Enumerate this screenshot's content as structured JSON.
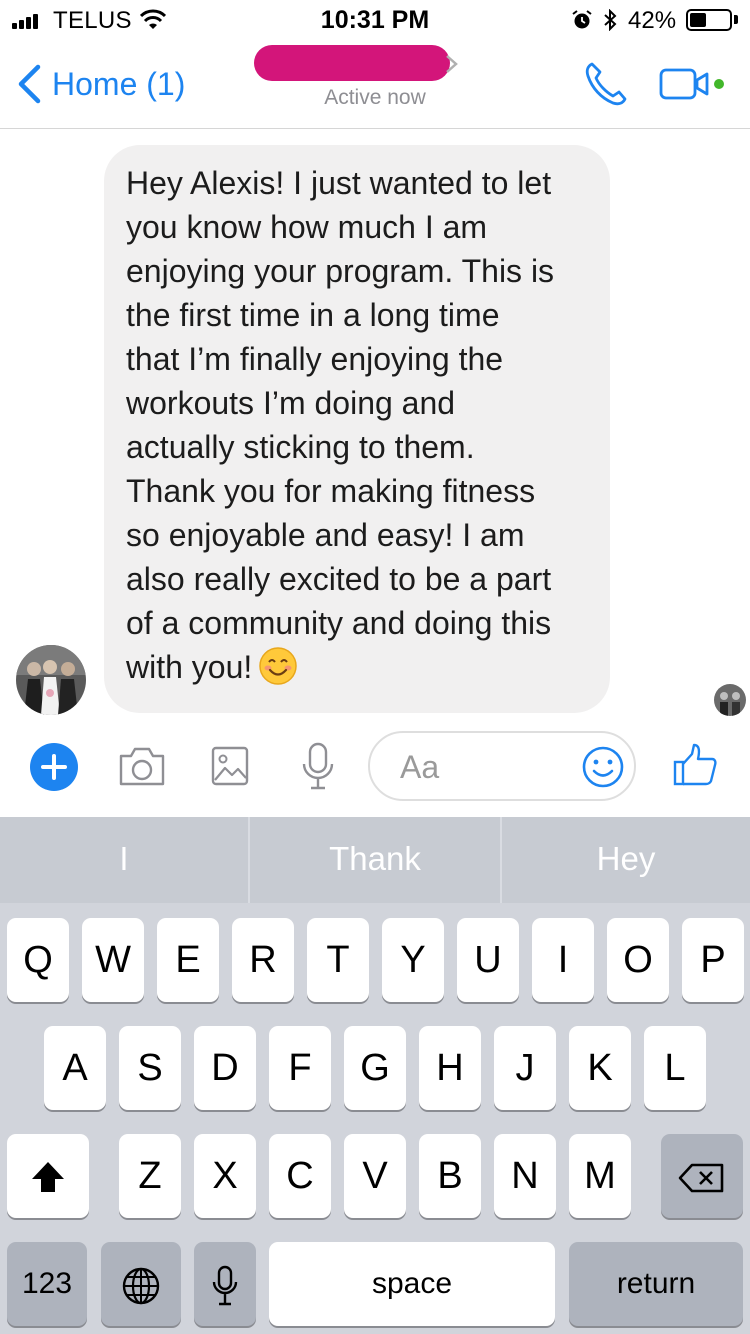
{
  "status_bar": {
    "carrier": "TELUS",
    "time": "10:31 PM",
    "battery_percent": "42%",
    "battery_level": 0.42,
    "icons": [
      "signal-icon",
      "wifi-icon",
      "alarm-icon",
      "bluetooth-icon",
      "battery-icon"
    ]
  },
  "nav": {
    "back_label": "Home (1)",
    "status": "Active now",
    "call_icon": "phone-icon",
    "video_icon": "video-camera-icon"
  },
  "message": {
    "text": "Hey Alexis! I just wanted to let\nyou know how much I am\nenjoying your program. This is\nthe first time in a long time\nthat I’m finally enjoying the\nworkouts I’m doing and\nactually sticking to them.\nThank you for making fitness\nso enjoyable and easy! I am\nalso really excited to be a part\nof a community and doing this\nwith you!",
    "emoji": "smiling-face-emoji"
  },
  "composer": {
    "placeholder": "Aa",
    "tools": [
      "plus-icon",
      "camera-icon",
      "image-icon",
      "microphone-icon"
    ],
    "emoji_icon": "smiley-icon",
    "like_icon": "thumbs-up-icon"
  },
  "keyboard": {
    "suggestions": [
      "I",
      "Thank",
      "Hey"
    ],
    "row1": [
      "Q",
      "W",
      "E",
      "R",
      "T",
      "Y",
      "U",
      "I",
      "O",
      "P"
    ],
    "row2": [
      "A",
      "S",
      "D",
      "F",
      "G",
      "H",
      "J",
      "K",
      "L"
    ],
    "row3": [
      "Z",
      "X",
      "C",
      "V",
      "B",
      "N",
      "M"
    ],
    "numbers_label": "123",
    "space_label": "space",
    "return_label": "return"
  },
  "colors": {
    "accent": "#1d84f0",
    "redaction": "#d3157a",
    "bubble": "#f1f0f0",
    "active_dot": "#42b72a"
  }
}
